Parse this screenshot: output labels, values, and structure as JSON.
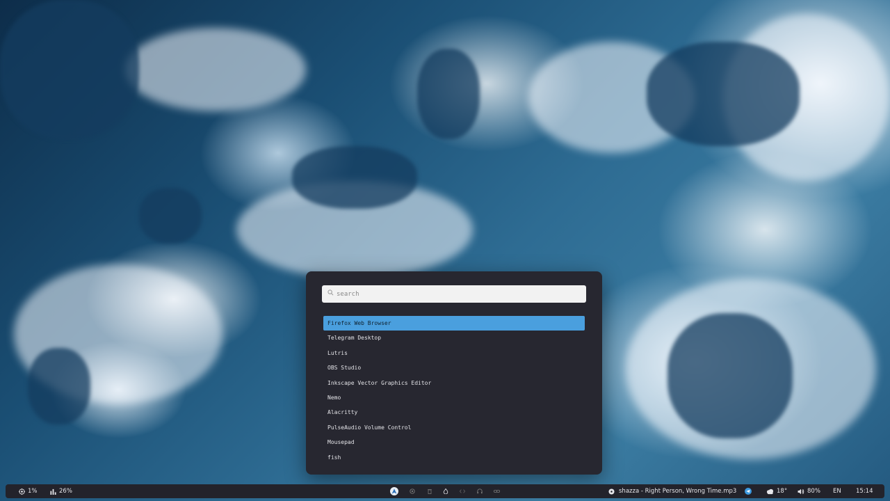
{
  "launcher": {
    "search_placeholder": "search",
    "search_value": "",
    "apps": [
      {
        "label": "Firefox Web Browser",
        "selected": true
      },
      {
        "label": "Telegram Desktop",
        "selected": false
      },
      {
        "label": "Lutris",
        "selected": false
      },
      {
        "label": "OBS Studio",
        "selected": false
      },
      {
        "label": "Inkscape Vector Graphics Editor",
        "selected": false
      },
      {
        "label": "Nemo",
        "selected": false
      },
      {
        "label": "Alacritty",
        "selected": false
      },
      {
        "label": "PulseAudio Volume Control",
        "selected": false
      },
      {
        "label": "Mousepad",
        "selected": false
      },
      {
        "label": "fish",
        "selected": false
      }
    ],
    "accent_color": "#4a9fde",
    "background_color": "#272730"
  },
  "taskbar": {
    "cpu": "1%",
    "memory": "26%",
    "now_playing": "shazza - Right Person, Wrong Time.mp3",
    "weather": "18°",
    "volume": "80%",
    "language": "EN",
    "clock": "15:14",
    "workspaces": [
      {
        "icon": "arch-logo-icon",
        "active": true
      },
      {
        "icon": "firefox-icon",
        "active": false
      },
      {
        "icon": "trash-icon",
        "active": false
      },
      {
        "icon": "fire-icon",
        "active": false
      },
      {
        "icon": "code-icon",
        "active": false
      },
      {
        "icon": "headphones-icon",
        "active": false
      },
      {
        "icon": "link-icon",
        "active": false
      }
    ]
  }
}
